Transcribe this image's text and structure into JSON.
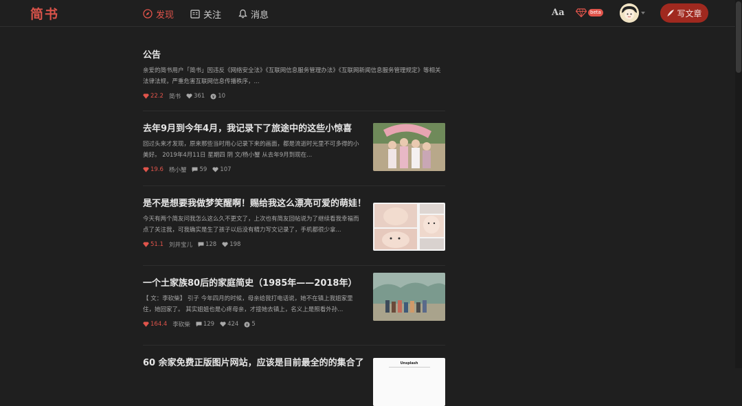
{
  "header": {
    "logo": "简书",
    "nav": [
      {
        "label": "发现",
        "active": true
      },
      {
        "label": "关注",
        "active": false
      },
      {
        "label": "消息",
        "active": false
      }
    ],
    "font_toggle": "Aa",
    "beta_badge": "beta",
    "write_label": "写文章"
  },
  "colors": {
    "accent": "#e0544b",
    "write_button": "#a0291f",
    "background": "#1f1f1f"
  },
  "articles": [
    {
      "title": "公告",
      "abstract": "亲爱的简书用户「简书」因违反《网络安全法》《互联网信息服务管理办法》《互联网新闻信息服务管理规定》等相关法律法规，严重危害互联网信息传播秩序，...",
      "diamonds": "22.2",
      "author": "简书",
      "comments": "",
      "likes": "361",
      "rewards": "10",
      "has_image": false
    },
    {
      "title": "去年9月到今年4月，我记录下了旅途中的这些小惊喜",
      "abstract": "回过头来才发现，原来那些当时用心记录下来的画面，都是流逝时光里不可多得的小美好。 2019年4月11日 星期四 阴 文/杨小蟹 从去年9月到现在...",
      "diamonds": "19.6",
      "author": "杨小蟹",
      "comments": "59",
      "likes": "107",
      "rewards": "",
      "has_image": true
    },
    {
      "title": "是不是想要我做梦笑醒啊！赐给我这么漂亮可爱的萌娃！",
      "abstract": "今天有两个简友问我怎么这么久不更文了，上次也有简友回帖说为了继续看我幸福而点了关注我，可我确实是生了孩子以后没有精力写文记录了，手机都很少拿...",
      "diamonds": "51.1",
      "author": "刘井宝儿",
      "comments": "128",
      "likes": "198",
      "rewards": "",
      "has_image": true
    },
    {
      "title": "一个土家族80后的家庭简史（1985年——2018年）",
      "abstract": "【 文：李砍柴】 引子 今年四月的时候，母亲给我打电话说，她不在镇上我姐家里住，她回家了。 其实姐姐也是心疼母亲，才接她去镇上，名义上是照看外孙...",
      "diamonds": "164.4",
      "author": "李砍柴",
      "comments": "129",
      "likes": "424",
      "rewards": "5",
      "has_image": true
    },
    {
      "title": "60 余家免费正版图片网站，应该是目前最全的的集合了",
      "abstract": "",
      "diamonds": "",
      "author": "",
      "comments": "",
      "likes": "",
      "rewards": "",
      "has_image": true,
      "image_caption": "Unsplash"
    }
  ]
}
